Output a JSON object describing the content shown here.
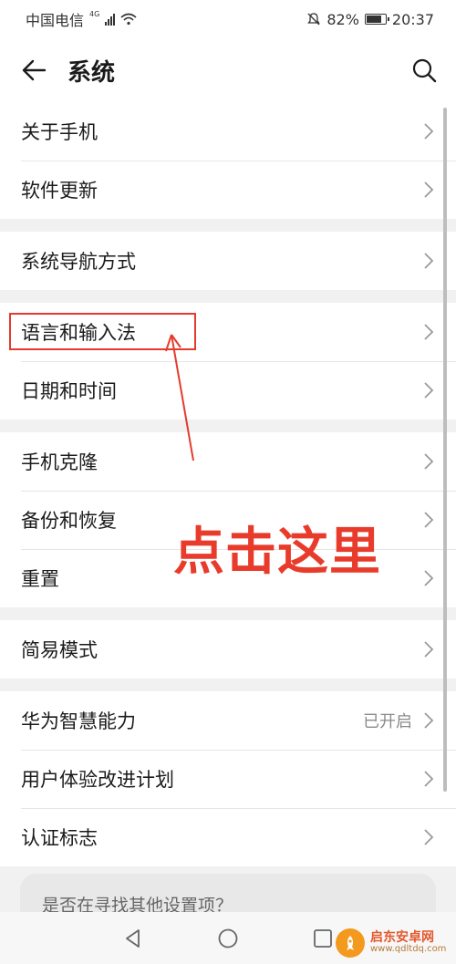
{
  "status_bar": {
    "carrier": "中国电信",
    "network": "4G",
    "battery": "82%",
    "battery_level": 0.82,
    "time": "20:37"
  },
  "header": {
    "title": "系统"
  },
  "groups": [
    {
      "items": [
        {
          "label": "关于手机"
        },
        {
          "label": "软件更新"
        }
      ]
    },
    {
      "items": [
        {
          "label": "系统导航方式"
        }
      ]
    },
    {
      "items": [
        {
          "label": "语言和输入法"
        },
        {
          "label": "日期和时间"
        }
      ]
    },
    {
      "items": [
        {
          "label": "手机克隆"
        },
        {
          "label": "备份和恢复"
        },
        {
          "label": "重置"
        }
      ]
    },
    {
      "items": [
        {
          "label": "简易模式"
        }
      ]
    },
    {
      "items": [
        {
          "label": "华为智慧能力",
          "value": "已开启"
        },
        {
          "label": "用户体验改进计划"
        },
        {
          "label": "认证标志"
        }
      ]
    }
  ],
  "hint_card": {
    "text": "是否在寻找其他设置项？"
  },
  "annotation": {
    "text": "点击这里",
    "color": "#e93b2b"
  },
  "watermark": {
    "name": "启东安卓网",
    "url": "www.qdltdq.com"
  },
  "icons": {
    "back": "arrow-left-icon",
    "search": "search-icon",
    "chevron": "chevron-right-icon",
    "nav_back": "triangle-back-icon",
    "nav_home": "circle-home-icon",
    "nav_recent": "square-recent-icon"
  }
}
